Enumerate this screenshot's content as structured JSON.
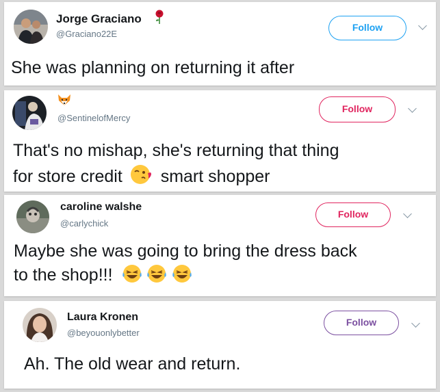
{
  "colors": {
    "background": "#d9d9d9",
    "follow_blue": "#1da1f2",
    "follow_red": "#e0245e",
    "handle_gray": "#657786"
  },
  "tweets": [
    {
      "name": "Jorge Graciano",
      "name_badge_icon": "rose-icon",
      "handle": "@Graciano22E",
      "follow_label": "Follow",
      "follow_style": "blue",
      "line1": "She was planning on returning it after"
    },
    {
      "name": "",
      "name_badge_icon": "fox-icon",
      "handle": "@SentinelofMercy",
      "follow_label": "Follow",
      "follow_style": "red",
      "line1": "That's no mishap, she's returning that thing",
      "line2_before": "for store credit",
      "line2_emoji": "face-blowing-kiss-icon",
      "line2_after": "smart shopper"
    },
    {
      "name": "caroline walshe",
      "handle": "@carlychick",
      "follow_label": "Follow",
      "follow_style": "red",
      "line1": "Maybe she was going to bring the dress back",
      "line2_before": "to the shop!!!",
      "line2_emoji": "crying-laughing-face-icon"
    },
    {
      "name": "Laura Kronen",
      "handle": "@beyouonlybetter",
      "follow_label": "Follow",
      "follow_style": "purple",
      "line1": "Ah. The old wear and return."
    }
  ]
}
